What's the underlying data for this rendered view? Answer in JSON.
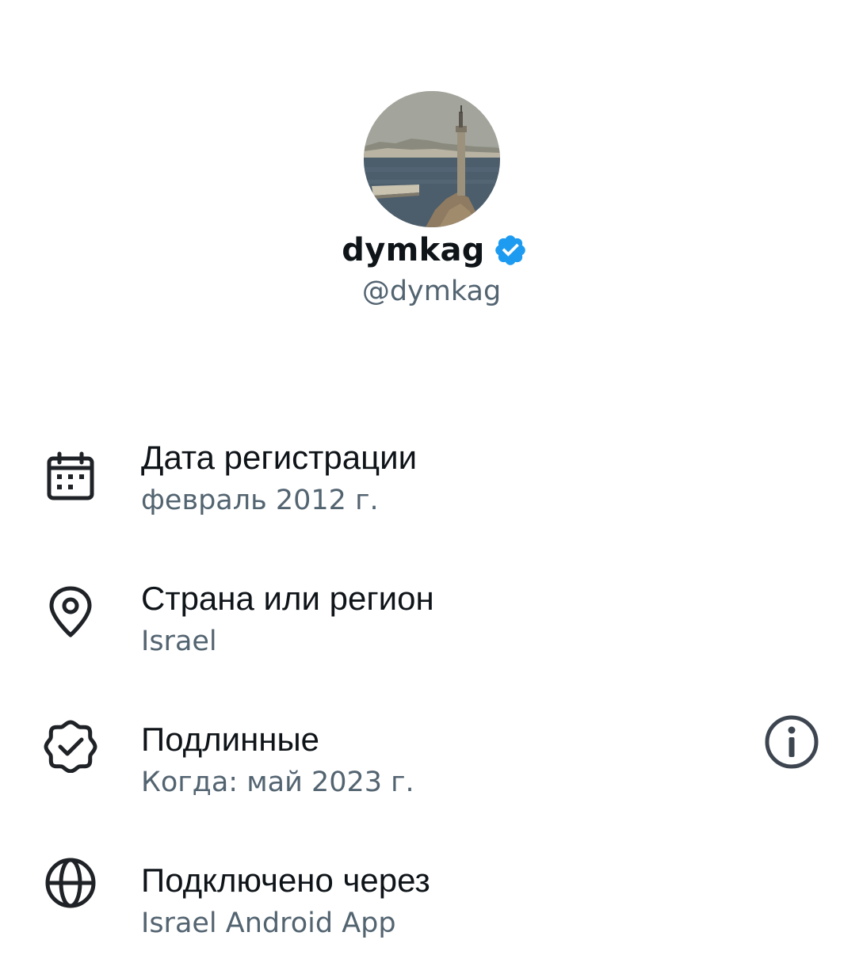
{
  "profile": {
    "display_name": "dymkag",
    "handle": "@dymkag",
    "verified_badge_icon": "verified-badge-icon",
    "verified_color": "#1d9bf0"
  },
  "about": {
    "items": [
      {
        "icon": "calendar-icon",
        "label": "Дата регистрации",
        "value": "февраль 2012 г."
      },
      {
        "icon": "location-pin-icon",
        "label": "Страна или регион",
        "value": "Israel"
      },
      {
        "icon": "verified-check-icon",
        "label": "Подлинные",
        "value": "Когда: май 2023 г.",
        "info_icon": "info-icon"
      },
      {
        "icon": "globe-icon",
        "label": "Подключено через",
        "value": "Israel Android App"
      }
    ]
  },
  "colors": {
    "primary_text": "#0f1419",
    "secondary_text": "#536471",
    "icon": "#1f2226"
  }
}
